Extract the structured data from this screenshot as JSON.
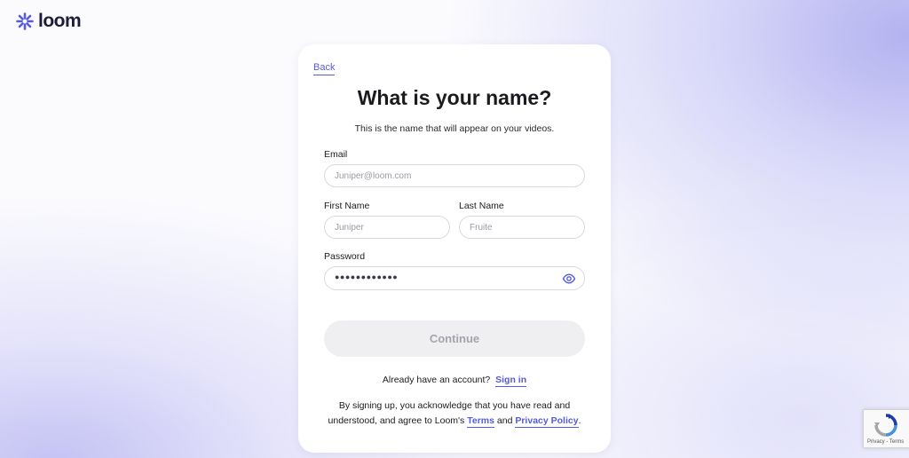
{
  "brand": {
    "name": "loom",
    "color": "#565ADD"
  },
  "card": {
    "back_label": "Back",
    "title": "What is your name?",
    "subtitle": "This is the name that will appear on your videos."
  },
  "form": {
    "email": {
      "label": "Email",
      "value": "",
      "placeholder": "Juniper@loom.com"
    },
    "first_name": {
      "label": "First Name",
      "value": "",
      "placeholder": "Juniper"
    },
    "last_name": {
      "label": "Last Name",
      "value": "",
      "placeholder": "Fruite"
    },
    "password": {
      "label": "Password",
      "masked_value": "●●●●●●●●●●●●",
      "toggle_icon": "eye-icon"
    },
    "continue_label": "Continue"
  },
  "signin": {
    "prompt": "Already have an account?",
    "link_label": "Sign in"
  },
  "legal": {
    "text_before": "By signing up, you acknowledge that you have read and understood, and agree to Loom's",
    "terms_label": "Terms",
    "and": "and",
    "privacy_label": "Privacy Policy",
    "end": "."
  },
  "recaptcha": {
    "links": "Privacy - Terms"
  }
}
